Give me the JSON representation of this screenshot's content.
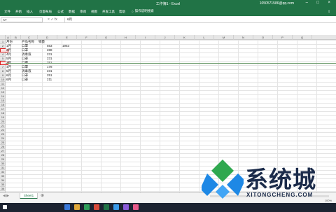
{
  "window": {
    "title": "工作簿1 - Excel",
    "account": "1050571586@qq.com"
  },
  "ribbon": {
    "tabs": [
      "文件",
      "开始",
      "插入",
      "页面布局",
      "公式",
      "数据",
      "审阅",
      "视图",
      "开发工具",
      "帮助"
    ],
    "tell_me": "操作说明搜索",
    "share": "共享"
  },
  "formula_bar": {
    "name_box": "A7",
    "fx_symbol": "fx",
    "value": "6月"
  },
  "columns": [
    "A",
    "B",
    "C",
    "D",
    "E",
    "F",
    "G",
    "H",
    "I",
    "J",
    "K",
    "L",
    "M",
    "N",
    "O",
    "P",
    "Q"
  ],
  "rows": [
    "1",
    "2",
    "3",
    "4",
    "5",
    "6",
    "7",
    "8",
    "9",
    "10",
    "11",
    "12",
    "13",
    "14",
    "15",
    "16",
    "17",
    "18",
    "19",
    "20",
    "21",
    "22",
    "23",
    "24",
    "25",
    "26",
    "27",
    "28",
    "29",
    "30",
    "31",
    "32",
    "33",
    "34",
    "35",
    "36"
  ],
  "table": {
    "headers": [
      "月份",
      "产品名称",
      "销量"
    ],
    "rows": [
      [
        "1月",
        "口罩",
        "563"
      ],
      [
        "2月",
        "口罩",
        "288"
      ],
      [
        "4月",
        "消毒液",
        "231"
      ],
      [
        "5月",
        "口罩",
        "231"
      ],
      [
        "3月",
        "口罩",
        "251"
      ],
      [
        "4月",
        "口罩",
        "178"
      ],
      [
        "5月",
        "消毒液",
        "231"
      ],
      [
        "6月",
        "口罩",
        "251"
      ],
      [
        "6月",
        "口罩",
        "211"
      ]
    ],
    "extra_value": "1953"
  },
  "sheet_tabs": [
    "Sheet1"
  ],
  "status": {
    "zoom": "100%"
  },
  "watermark": {
    "text": "系统城",
    "url": "XITONGCHENG.COM"
  },
  "colors": {
    "excel_green": "#217346",
    "marker_red": "#d22222"
  }
}
